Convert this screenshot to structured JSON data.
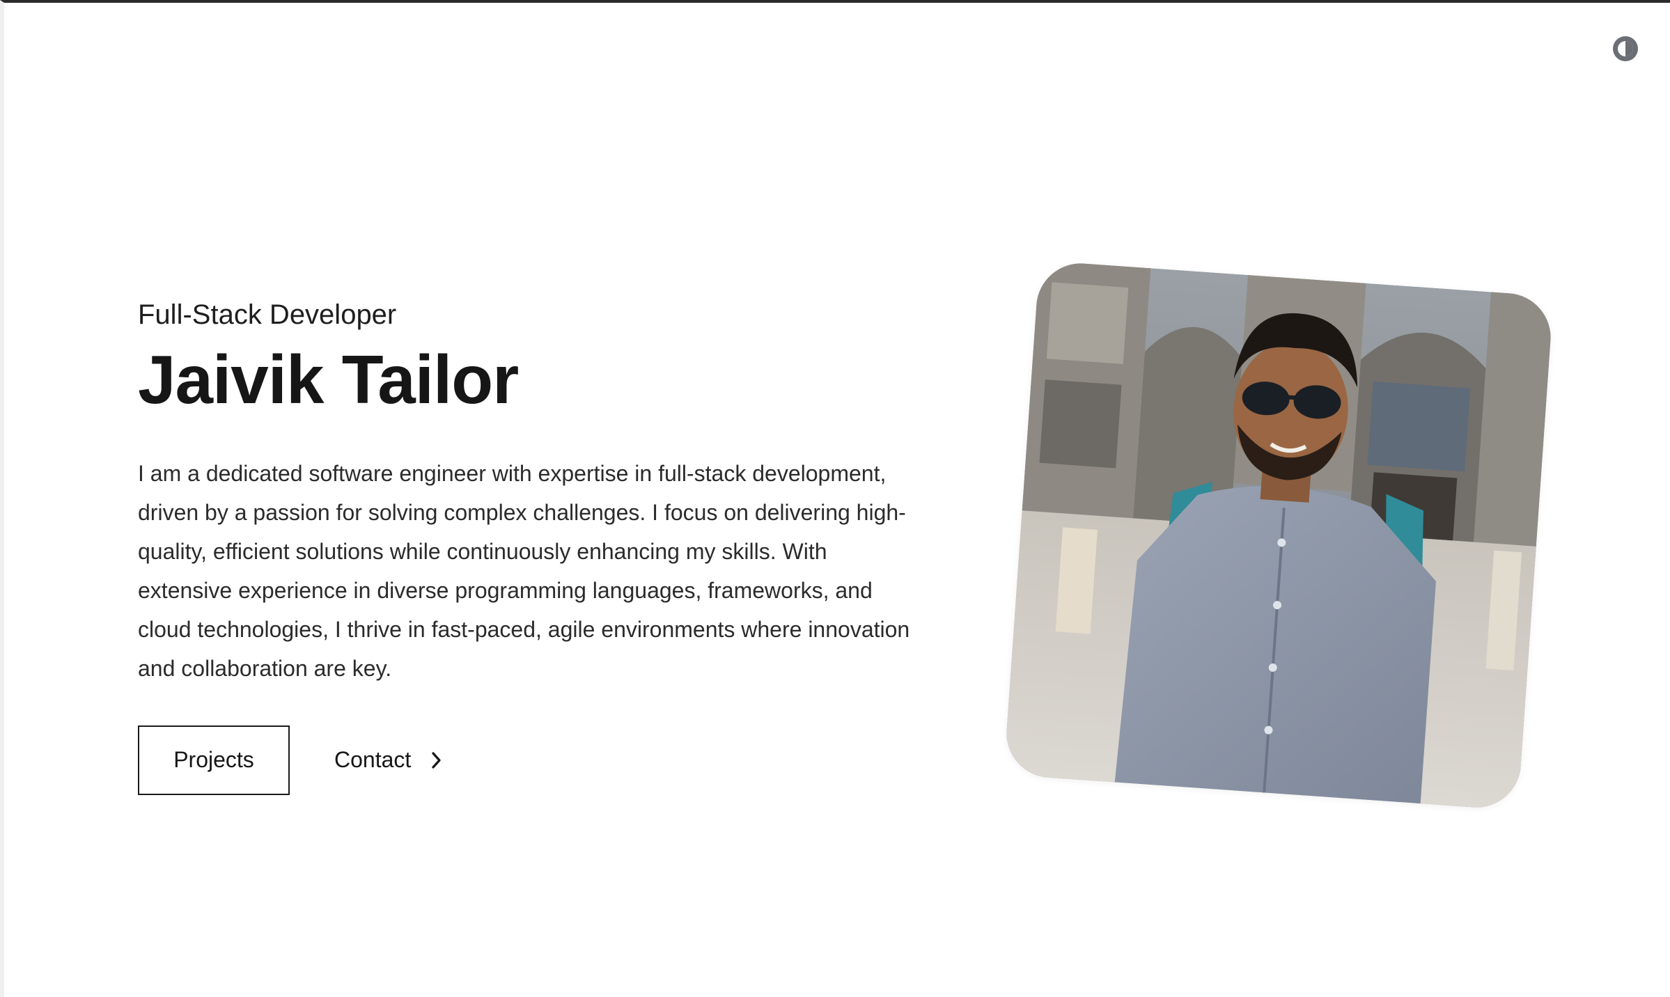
{
  "header": {
    "theme_toggle_icon": "contrast-icon"
  },
  "hero": {
    "subtitle": "Full-Stack Developer",
    "name": "Jaivik Tailor",
    "bio": "I am a dedicated software engineer with expertise in full-stack development, driven by a passion for solving complex challenges. I focus on delivering high-quality, efficient solutions while continuously enhancing my skills. With extensive experience in diverse programming languages, frameworks, and cloud technologies, I thrive in fast-paced, agile environments where innovation and collaboration are key.",
    "projects_label": "Projects",
    "contact_label": "Contact",
    "contact_icon": "chevron-right-icon"
  },
  "photo": {
    "alt": "Portrait photo"
  },
  "colors": {
    "text": "#161616",
    "background": "#ffffff",
    "icon": "#6b6f75"
  }
}
